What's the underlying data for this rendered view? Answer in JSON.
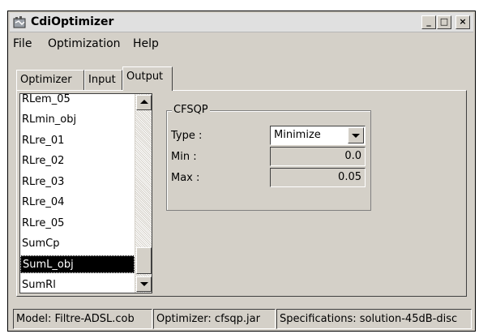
{
  "window": {
    "title": "CdiOptimizer",
    "controls": {
      "minimize": "_",
      "maximize": "□",
      "close": "×"
    }
  },
  "menu": [
    "File",
    "Optimization",
    "Help"
  ],
  "tabs": [
    {
      "label": "Optimizer",
      "active": false
    },
    {
      "label": "Input",
      "active": false
    },
    {
      "label": "Output",
      "active": true
    }
  ],
  "list": {
    "items": [
      "RLem_05",
      "RLmin_obj",
      "RLre_01",
      "RLre_02",
      "RLre_03",
      "RLre_04",
      "RLre_05",
      "SumCp",
      "SumL_obj",
      "SumRl"
    ],
    "selected": "SumL_obj"
  },
  "group": {
    "title": "CFSQP",
    "type_label": "Type :",
    "type_value": "Minimize",
    "min_label": "Min :",
    "min_value": "0.0",
    "max_label": "Max :",
    "max_value": "0.05"
  },
  "status": {
    "model": "Model: Filtre-ADSL.cob",
    "optimizer": "Optimizer: cfsqp.jar",
    "specifications": "Specifications: solution-45dB-disc"
  },
  "colors": {
    "face": "#d4d0c8",
    "selection": "#000000"
  }
}
